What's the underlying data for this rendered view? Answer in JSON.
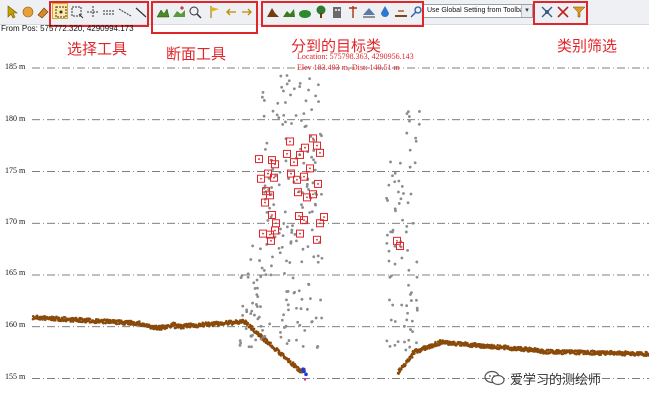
{
  "toolbar": {
    "select_tools": [
      "pointer-tool",
      "pan-tool",
      "eraser-tool",
      "rect-select-tool",
      "box-select-tool",
      "zoom-tool",
      "section-tool-1",
      "section-tool-2",
      "line-tool"
    ],
    "section_tools": [
      "terrain-profile-tool",
      "profile-add-tool",
      "profile-zoom-tool",
      "profile-left-tool",
      "profile-move-tool",
      "profile-right-tool"
    ],
    "class_tools": [
      "ground-class-icon",
      "vegetation-class-icon",
      "low-veg-class-icon",
      "tree-class-icon",
      "building-class-icon",
      "pole-class-icon",
      "wire-class-icon",
      "water-class-icon",
      "road-class-icon",
      "key-class-icon"
    ],
    "filter_select_value": "Use Global Setting from Toolbar",
    "extra_tools": [
      "class-filter-icon",
      "clear-filter-icon",
      "funnel-icon"
    ]
  },
  "from_pos": "From Pos: 575772.320, 4290994.173",
  "labels": {
    "select_tools": "选择工具",
    "section_tools": "断面工具",
    "classified_targets": "分到的目标类",
    "class_filter": "类别筛选"
  },
  "annotation": {
    "location": "Location: 575798.363, 4290956.143",
    "elev_dist": "Elev 183.493 m, Dist: 140.51 m"
  },
  "y_axis": {
    "unit": "m",
    "ticks": [
      "185 m",
      "180 m",
      "175 m",
      "170 m",
      "165 m",
      "160 m",
      "155 m"
    ]
  },
  "watermark": "爱学习的测绘师",
  "colors": {
    "red_box": "#e0262b",
    "ground_points": "#8a4a0a",
    "vegetation_points": "#8c8c8c",
    "grid": "#555555"
  }
}
